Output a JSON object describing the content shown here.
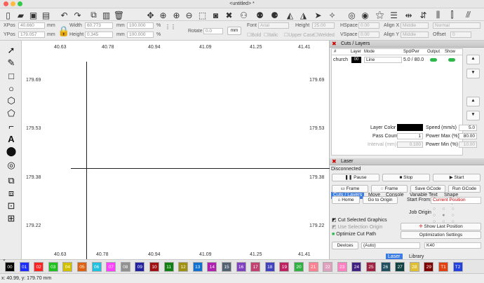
{
  "window": {
    "title": "<untitled> *"
  },
  "toolbar": {
    "icons": [
      "new-file-icon",
      "open-folder-icon",
      "save-icon",
      "save-as-icon",
      "undo-icon",
      "redo-icon",
      "copy-icon",
      "paste-icon",
      "delete-icon",
      "move-icon",
      "zoom-fit-icon",
      "zoom-in-icon",
      "zoom-out-icon",
      "select-frame-icon",
      "camera-icon",
      "settings-icon",
      "users-icon",
      "group-icon",
      "ungroup-icon",
      "triangle-icon",
      "paper-plane-icon",
      "laser-target-icon",
      "magic-wand-icon",
      "sliders-icon",
      "mirror-icon",
      "flip-icon"
    ]
  },
  "props": {
    "xpos_label": "XPos",
    "xpos_value": "40.660",
    "ypos_label": "YPos",
    "ypos_value": "179.057",
    "unit": "mm",
    "width_label": "Width",
    "width_value": "60.773",
    "height_label": "Height",
    "height_value": "0.345",
    "scale_w": "100.000",
    "scale_h": "100.000",
    "pct": "%",
    "rotate_label": "Rotate",
    "rotate_value": "0.0",
    "rotate_unit": "mm",
    "font_label": "Font",
    "font_value": "Arial",
    "fheight_label": "Height",
    "fheight_value": "25.00",
    "bold_label": "Bold",
    "italic_label": "Italic",
    "upper_label": "Upper Case",
    "welded_label": "Welded",
    "hspace_label": "HSpace",
    "hspace_value": "0.00",
    "vspace_label": "VSpace",
    "vspace_value": "0.00",
    "alignx_label": "Align X",
    "alignx_value": "Middle",
    "aligny_label": "Align Y",
    "aligny_value": "Middle",
    "normal_value": "Normal",
    "offset_label": "Offset",
    "offset_value": "0"
  },
  "canvas": {
    "top_ticks": [
      "40.63",
      "40.78",
      "40.94",
      "41.09",
      "41.25",
      "41.41"
    ],
    "bottom_ticks": [
      "40.63",
      "40.78",
      "40.94",
      "41.09",
      "41.25",
      "41.41"
    ],
    "left_ticks": [
      "179.69",
      "179.53",
      "179.38",
      "179.22"
    ],
    "right_ticks": [
      "179.69",
      "179.53",
      "179.38",
      "179.22"
    ]
  },
  "cuts": {
    "header": "Cuts / Layers",
    "cols": [
      "#",
      "Layer",
      "Mode",
      "Spd/Pwr",
      "Output",
      "Show"
    ],
    "row": {
      "name": "church",
      "layer": "00",
      "mode": "Line",
      "spdpwr": "5.0 / 80.0"
    },
    "layer_color_label": "Layer Color",
    "speed_label": "Speed (mm/s)",
    "speed_value": "5.0",
    "pass_label": "Pass Count",
    "pass_value": "1",
    "pmax_label": "Power Max (%)",
    "pmax_value": "80.00",
    "interval_label": "Interval (mm)",
    "interval_value": "0.100",
    "pmin_label": "Power Min (%)",
    "pmin_value": "10.00",
    "tabs": [
      "Cuts / Layers",
      "Move",
      "Console",
      "Variable Text",
      "Shape Properties"
    ]
  },
  "laser": {
    "header": "Laser",
    "status": "Disconnected",
    "pause": "Pause",
    "stop": "Stop",
    "start": "Start",
    "frame1": "Frame",
    "frame2": "Frame",
    "save_gcode": "Save GCode",
    "run_gcode": "Run GCode",
    "home": "Home",
    "goto_origin": "Go to Origin",
    "start_from_label": "Start From:",
    "start_from_value": "Current Position",
    "job_origin_label": "Job Origin",
    "cut_selected": "Cut Selected Graphics",
    "use_selection_origin": "Use Selection Origin",
    "optimize": "Optimize Cut Path",
    "show_last": "Show Last Position",
    "opt_settings": "Optimization Settings",
    "devices": "Devices",
    "devices_value": "(Auto)",
    "machine_value": "K40",
    "bottom_tabs": [
      "Laser",
      "Library"
    ]
  },
  "palette": {
    "labels": [
      "00",
      "01",
      "02",
      "03",
      "04",
      "05",
      "06",
      "07",
      "08",
      "09",
      "10",
      "11",
      "12",
      "13",
      "14",
      "15",
      "16",
      "17",
      "18",
      "19",
      "20",
      "21",
      "22",
      "23",
      "24",
      "25",
      "26",
      "27",
      "28",
      "29",
      "T1",
      "T2"
    ],
    "colors": [
      "#000000",
      "#1a2cff",
      "#ff2020",
      "#20c020",
      "#d0c000",
      "#e06010",
      "#20c0e0",
      "#ff40ff",
      "#909090",
      "#2020a0",
      "#a01010",
      "#108010",
      "#a09010",
      "#1070d0",
      "#b020b0",
      "#506070",
      "#8040c0",
      "#c04070",
      "#4040c0",
      "#c02060",
      "#30b040",
      "#ff8090",
      "#e0a0c0",
      "#ff80c0",
      "#402080",
      "#a02040",
      "#205060",
      "#104040",
      "#e0c030",
      "#800000",
      "#e04010",
      "#2040e0"
    ]
  },
  "status": {
    "coords": "x: 40.99, y: 179.70 mm"
  }
}
